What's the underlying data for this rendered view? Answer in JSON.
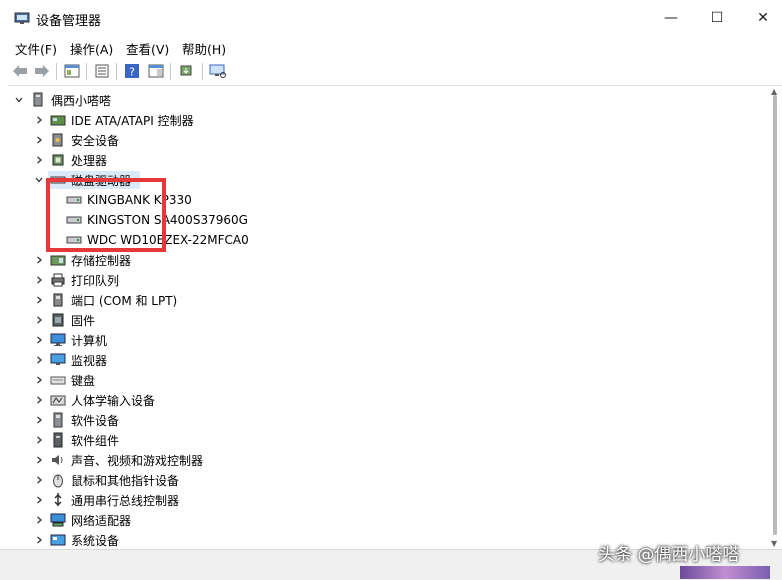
{
  "window": {
    "title": "设备管理器",
    "controls": {
      "minimize": "—",
      "maximize": "☐",
      "close": "✕"
    }
  },
  "menu": [
    "文件(F)",
    "操作(A)",
    "查看(V)",
    "帮助(H)"
  ],
  "tree": {
    "root": "偶西小嗒嗒",
    "categories": [
      {
        "label": "IDE ATA/ATAPI 控制器",
        "icon": "ide-controller-icon",
        "expanded": false
      },
      {
        "label": "安全设备",
        "icon": "security-device-icon",
        "expanded": false
      },
      {
        "label": "处理器",
        "icon": "processor-icon",
        "expanded": false
      },
      {
        "label": "磁盘驱动器",
        "icon": "disk-drive-icon",
        "expanded": true,
        "children": [
          "KINGBANK KP330",
          "KINGSTON SA400S37960G",
          "WDC WD10EZEX-22MFCA0"
        ]
      },
      {
        "label": "存储控制器",
        "icon": "storage-controller-icon",
        "expanded": false
      },
      {
        "label": "打印队列",
        "icon": "printer-icon",
        "expanded": false
      },
      {
        "label": "端口 (COM 和 LPT)",
        "icon": "port-icon",
        "expanded": false
      },
      {
        "label": "固件",
        "icon": "firmware-icon",
        "expanded": false
      },
      {
        "label": "计算机",
        "icon": "computer-icon",
        "expanded": false
      },
      {
        "label": "监视器",
        "icon": "monitor-icon",
        "expanded": false
      },
      {
        "label": "键盘",
        "icon": "keyboard-icon",
        "expanded": false
      },
      {
        "label": "人体学输入设备",
        "icon": "hid-icon",
        "expanded": false
      },
      {
        "label": "软件设备",
        "icon": "software-device-icon",
        "expanded": false
      },
      {
        "label": "软件组件",
        "icon": "software-component-icon",
        "expanded": false
      },
      {
        "label": "声音、视频和游戏控制器",
        "icon": "sound-icon",
        "expanded": false
      },
      {
        "label": "鼠标和其他指针设备",
        "icon": "mouse-icon",
        "expanded": false
      },
      {
        "label": "通用串行总线控制器",
        "icon": "usb-icon",
        "expanded": false
      },
      {
        "label": "网络适配器",
        "icon": "network-adapter-icon",
        "expanded": false
      },
      {
        "label": "系统设备",
        "icon": "system-device-icon",
        "expanded": false
      }
    ]
  },
  "watermark": "头条 @偶西小嗒嗒",
  "colors": {
    "highlight": "#dbe9f8",
    "annotation": "#e5383b"
  }
}
